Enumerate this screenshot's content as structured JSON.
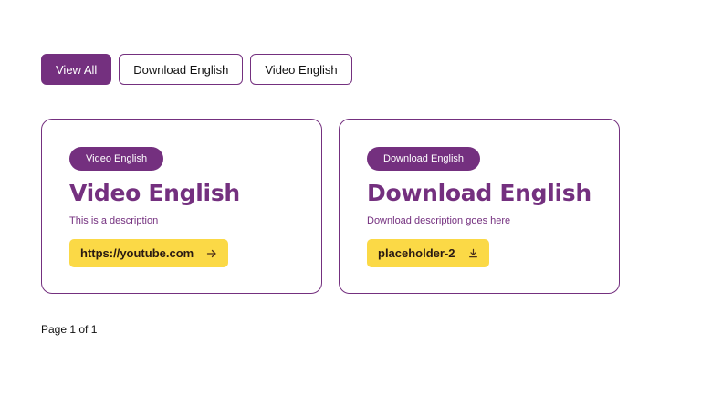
{
  "filters": {
    "view_all": "View All",
    "download_english": "Download English",
    "video_english": "Video English"
  },
  "cards": [
    {
      "tag": "Video English",
      "title": "Video English",
      "description": "This is a description",
      "link_text": "https://youtube.com",
      "link_icon": "arrow-right-icon"
    },
    {
      "tag": "Download English",
      "title": "Download English",
      "description": "Download description goes here",
      "link_text": "placeholder-2",
      "link_icon": "download-icon"
    }
  ],
  "pagination": {
    "text": "Page 1 of 1"
  },
  "colors": {
    "primary": "#74307f",
    "accent": "#fbd946"
  }
}
